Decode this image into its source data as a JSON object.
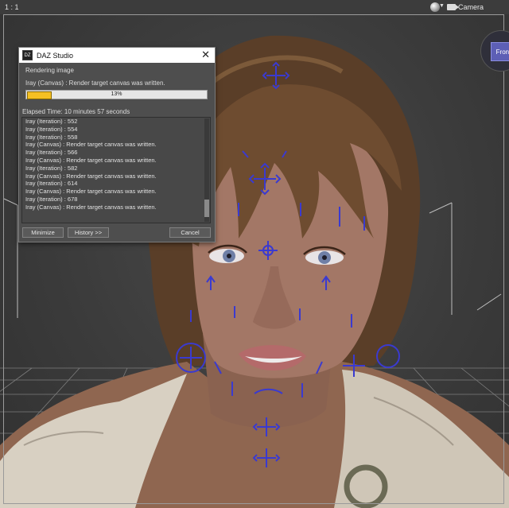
{
  "viewport": {
    "ratio": "1 : 1",
    "camera_label": "Camera",
    "nav_cube_label": "Front"
  },
  "dialog": {
    "title": "DAZ Studio",
    "logo_text": "DZ",
    "status_heading": "Rendering image",
    "status_line": "Iray (Canvas) : Render target canvas was written.",
    "progress": {
      "percent": 13,
      "label": "13%"
    },
    "elapsed": "Elapsed Time:  10 minutes 57 seconds",
    "log": [
      "Iray (Iteration) : 552",
      "Iray (Iteration) : 554",
      "Iray (Iteration) : 558",
      "Iray (Canvas) : Render target canvas was written.",
      "Iray (Iteration) : 566",
      "Iray (Canvas) : Render target canvas was written.",
      "Iray (Iteration) : 582",
      "Iray (Canvas) : Render target canvas was written.",
      "Iray (Iteration) : 614",
      "Iray (Canvas) : Render target canvas was written.",
      "Iray (Iteration) : 678",
      "Iray (Canvas) : Render target canvas was written."
    ],
    "buttons": {
      "minimize": "Minimize",
      "history": "History >>",
      "cancel": "Cancel"
    }
  },
  "colors": {
    "progress_fill": "#f5c023",
    "handles": "#3a3ad0"
  }
}
